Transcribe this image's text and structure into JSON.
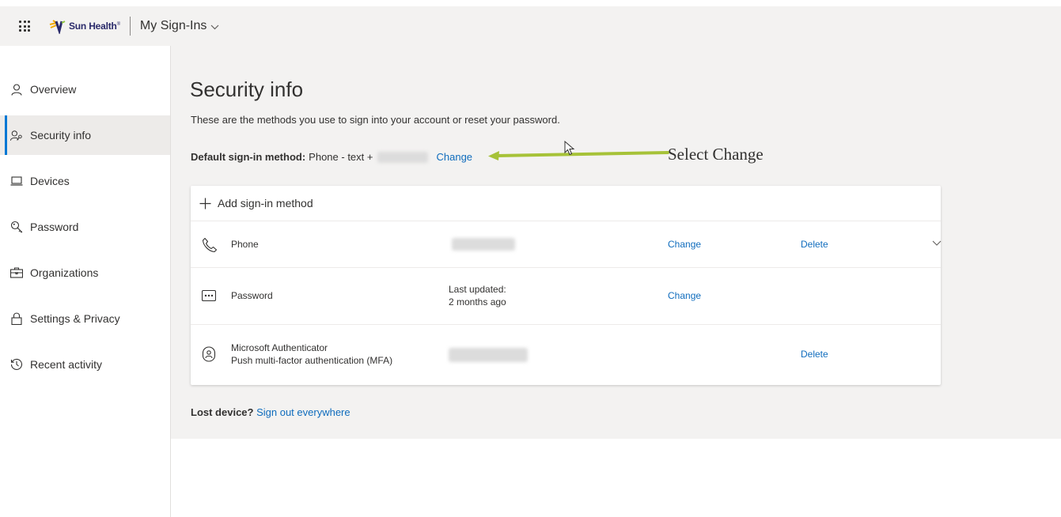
{
  "header": {
    "brand_name": "Sun Health",
    "brand_mark": "®",
    "app_title": "My Sign-Ins"
  },
  "sidebar": {
    "items": [
      {
        "label": "Overview",
        "icon": "person-icon"
      },
      {
        "label": "Security info",
        "icon": "person-key-icon",
        "active": true
      },
      {
        "label": "Devices",
        "icon": "laptop-icon"
      },
      {
        "label": "Password",
        "icon": "key-icon"
      },
      {
        "label": "Organizations",
        "icon": "briefcase-icon"
      },
      {
        "label": "Settings & Privacy",
        "icon": "lock-icon"
      },
      {
        "label": "Recent activity",
        "icon": "history-icon"
      }
    ]
  },
  "main": {
    "title": "Security info",
    "subtitle": "These are the methods you use to sign into your account or reset your password.",
    "default_label": "Default sign-in method:",
    "default_value": "Phone - text +",
    "default_change": "Change",
    "annotation": "Select Change",
    "add_method": "Add sign-in method",
    "methods": [
      {
        "name": "Phone",
        "detail": "",
        "change": "Change",
        "delete": "Delete"
      },
      {
        "name": "Password",
        "detail_line1": "Last updated:",
        "detail_line2": "2 months ago",
        "change": "Change"
      },
      {
        "name_line1": "Microsoft Authenticator",
        "name_line2": "Push multi-factor authentication (MFA)",
        "delete": "Delete"
      }
    ],
    "lost_label": "Lost device?",
    "lost_link": "Sign out everywhere"
  },
  "colors": {
    "accent": "#0078d4",
    "link": "#0f6cbd",
    "annotation_arrow": "#a6c238",
    "page_bg": "#f3f2f1"
  }
}
